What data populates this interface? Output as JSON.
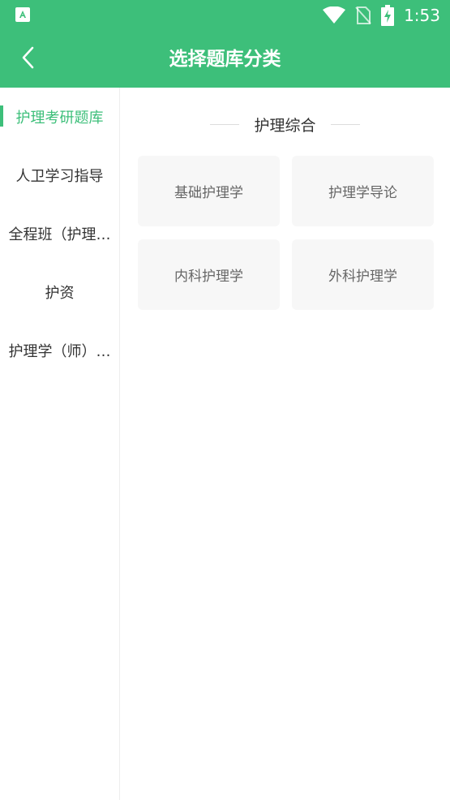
{
  "status_bar": {
    "time": "1:53",
    "icons": [
      "app-a-icon",
      "wifi-icon",
      "no-sim-icon",
      "battery-charging-icon"
    ]
  },
  "app_bar": {
    "title": "选择题库分类",
    "back_icon": "chevron-left-icon"
  },
  "colors": {
    "primary": "#3dbf7a",
    "card_bg": "#f7f7f7",
    "text_dark": "#333333",
    "text_muted": "#666666"
  },
  "sidebar": {
    "items": [
      {
        "label": "护理考研题库",
        "active": true
      },
      {
        "label": "人卫学习指导",
        "active": false
      },
      {
        "label": "全程班（护理…",
        "active": false
      },
      {
        "label": "护资",
        "active": false
      },
      {
        "label": "护理学（师）…",
        "active": false
      }
    ]
  },
  "main": {
    "section_title": "护理综合",
    "cards": [
      {
        "label": "基础护理学"
      },
      {
        "label": "护理学导论"
      },
      {
        "label": "内科护理学"
      },
      {
        "label": "外科护理学"
      }
    ]
  }
}
